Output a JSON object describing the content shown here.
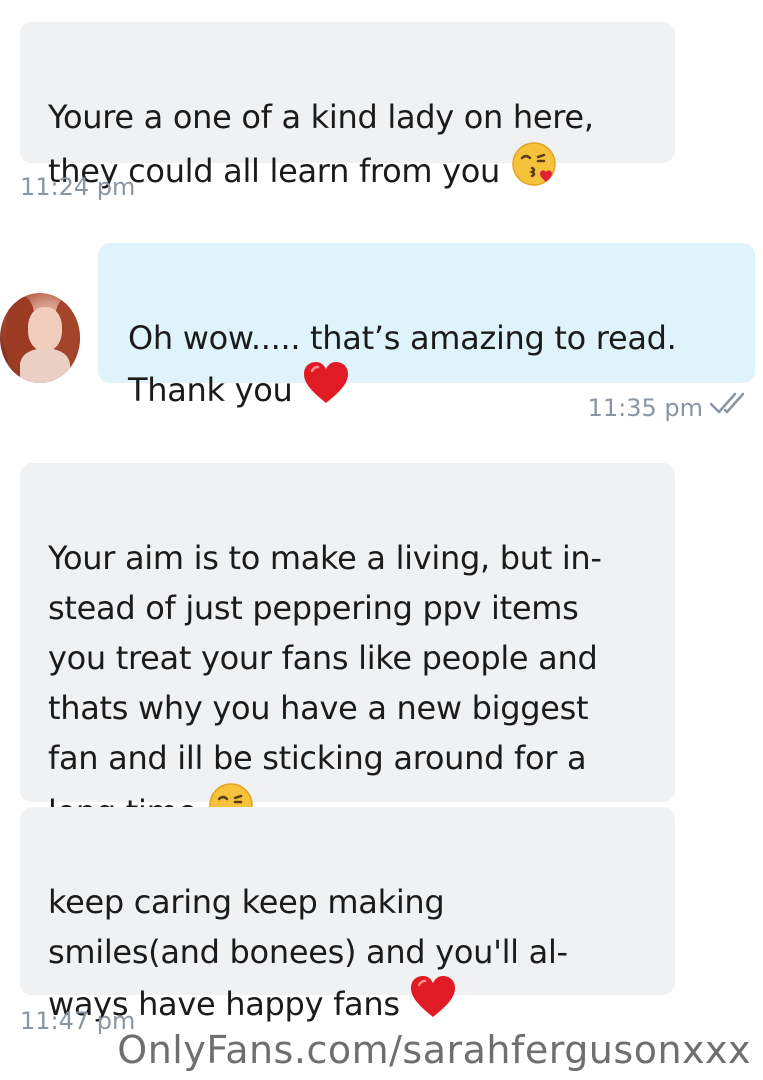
{
  "messages": [
    {
      "text": "Youre a one of a kind lady on here,\nthey could all learn from you",
      "emoji": "kissing-face-icon",
      "time": "11:24 pm"
    },
    {
      "text": "Oh wow..... that’s amazing to read.\nThank you",
      "emoji": "red-heart-icon",
      "time": "11:35 pm",
      "status": "read-double-check-icon"
    },
    {
      "text": "Your aim is to make a living, but in-\nstead of just peppering ppv items\nyou treat your fans like people and\nthats why you have a new biggest\nfan and ill be sticking around for a\nlong time",
      "emoji": "kissing-face-icon"
    },
    {
      "text": "keep caring keep making\nsmiles(and bonees) and you'll al-\nways have happy fans",
      "emoji": "red-heart-icon",
      "time": "11:47 pm"
    }
  ],
  "watermark": "OnlyFans.com/sarahfergusonxxx",
  "colors": {
    "incoming_bubble": "#eff1f3",
    "outgoing_bubble": "#dff3fb",
    "timestamp": "#8a96a3",
    "heart": "#e01b24"
  }
}
